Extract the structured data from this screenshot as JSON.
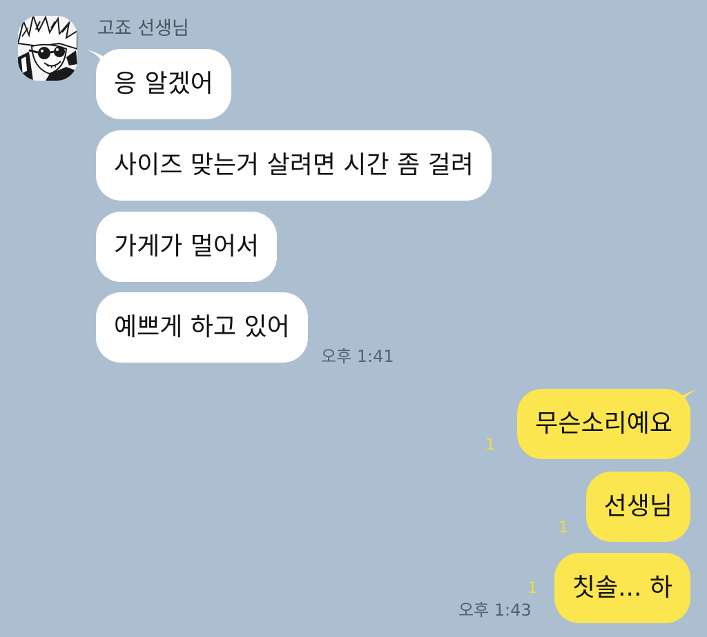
{
  "chat": {
    "sender_name": "고죠 선생님",
    "avatar_icon": "manga-character-with-sunglasses",
    "incoming": [
      {
        "text": "응 알겠어"
      },
      {
        "text": "사이즈 맞는거 살려면 시간 좀 걸려"
      },
      {
        "text": "가게가 멀어서"
      },
      {
        "text": "예쁘게 하고 있어"
      }
    ],
    "incoming_time": "오후 1:41",
    "outgoing": [
      {
        "text": "무슨소리예요",
        "unread": "1"
      },
      {
        "text": "선생님",
        "unread": "1"
      },
      {
        "text": "칫솔... 하",
        "unread": "1"
      }
    ],
    "outgoing_time": "오후 1:43"
  },
  "colors": {
    "background": "#abbfd0",
    "incoming_bubble": "#ffffff",
    "outgoing_bubble": "#fbe650",
    "unread_count": "#f3dd33"
  }
}
